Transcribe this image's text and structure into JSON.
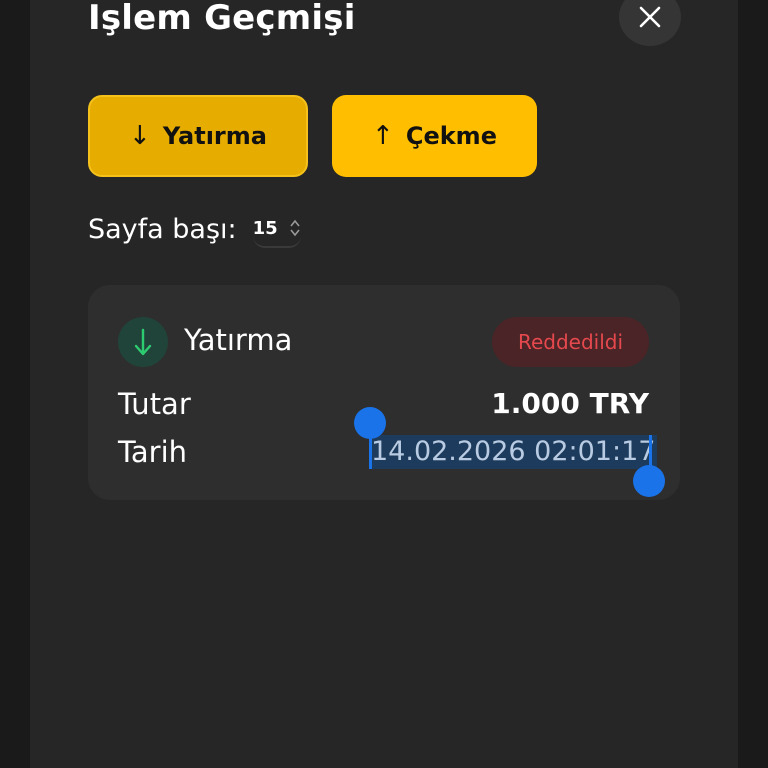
{
  "header": {
    "title": "Işlem Geçmişi",
    "close_icon": "close-icon"
  },
  "actions": {
    "deposit": {
      "arrow": "↓",
      "label": "Yatırma"
    },
    "withdraw": {
      "arrow": "↑",
      "label": "Çekme"
    }
  },
  "pagination": {
    "label": "Sayfa başı:",
    "per_page_value": "15"
  },
  "transactions": [
    {
      "type": "Yatırma",
      "direction_icon": "arrow-down-icon",
      "status": "Reddedildi",
      "amount_label": "Tutar",
      "amount": "1.000 TRY",
      "date_label": "Tarih",
      "date": "14.02.2026 02:01:17"
    }
  ],
  "colors": {
    "accent_yellow": "#ffbf00",
    "deposit_green": "#2ecc71",
    "rejected_red": "#e5484d",
    "selection_blue": "#1a73e8"
  }
}
